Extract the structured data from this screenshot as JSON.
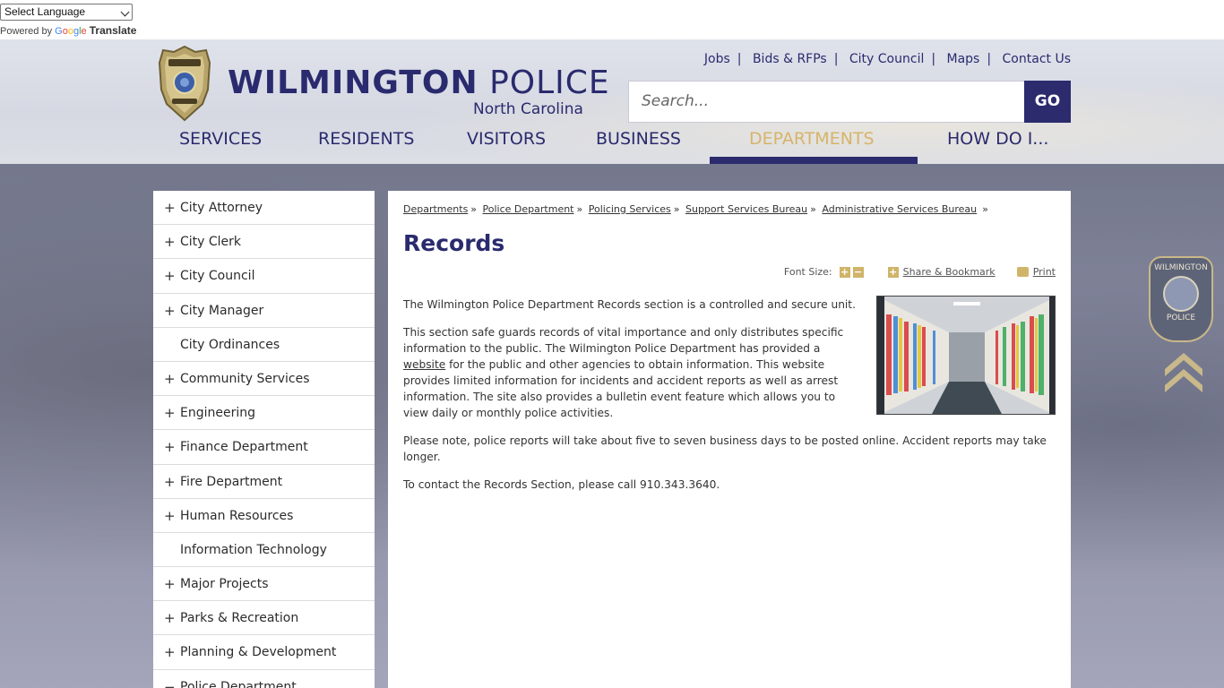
{
  "translate": {
    "select_label": "Select Language",
    "powered_by": "Powered by",
    "google": "Google",
    "translate": "Translate"
  },
  "header": {
    "title_bold": "WILMINGTON",
    "title_regular": "POLICE",
    "subtitle": "North Carolina",
    "badge_icon": "police-badge-icon",
    "top_links": [
      "Jobs",
      "Bids & RFPs",
      "City Council",
      "Maps",
      "Contact Us"
    ],
    "search_placeholder": "Search...",
    "go_label": "GO"
  },
  "nav": {
    "items": [
      "SERVICES",
      "RESIDENTS",
      "VISITORS",
      "BUSINESS",
      "DEPARTMENTS",
      "HOW DO I..."
    ],
    "active": "DEPARTMENTS"
  },
  "colors": {
    "brand": "#2a2a6e",
    "accent": "#d6b46a"
  },
  "sidebar": {
    "items": [
      {
        "label": "City Attorney",
        "expandable": true
      },
      {
        "label": "City Clerk",
        "expandable": true
      },
      {
        "label": "City Council",
        "expandable": true
      },
      {
        "label": "City Manager",
        "expandable": true
      },
      {
        "label": "City Ordinances",
        "expandable": false
      },
      {
        "label": "Community Services",
        "expandable": true
      },
      {
        "label": "Engineering",
        "expandable": true
      },
      {
        "label": "Finance Department",
        "expandable": true
      },
      {
        "label": "Fire Department",
        "expandable": true
      },
      {
        "label": "Human Resources",
        "expandable": true
      },
      {
        "label": "Information Technology",
        "expandable": false
      },
      {
        "label": "Major Projects",
        "expandable": true
      },
      {
        "label": "Parks & Recreation",
        "expandable": true
      },
      {
        "label": "Planning & Development",
        "expandable": true
      },
      {
        "label": "Police Department",
        "expandable": true
      }
    ]
  },
  "breadcrumb": [
    "Departments",
    "Police Department",
    "Policing Services",
    "Support Services Bureau",
    "Administrative Services Bureau"
  ],
  "page": {
    "title": "Records",
    "font_size_label": "Font Size:",
    "share_label": "Share & Bookmark",
    "print_label": "Print",
    "p1": "The Wilmington Police Department Records section is a controlled and secure unit.",
    "p2_before": "This section safe guards records of vital importance and only distributes specific information to the public. The Wilmington Police Department has provided a ",
    "p2_link": "website",
    "p2_after": " for the public and other agencies to obtain information. This website provides limited information for incidents and accident reports as well as arrest information. The site also provides a bulletin event feature which allows you to view daily or monthly police activities.",
    "p3": "Please note, police reports will take about five to seven business days to be posted online. Accident reports may take longer.",
    "p4": "To contact the Records Section, please call 910.343.3640."
  },
  "patch": {
    "text_top": "WILMINGTON",
    "text_bottom": "POLICE"
  }
}
